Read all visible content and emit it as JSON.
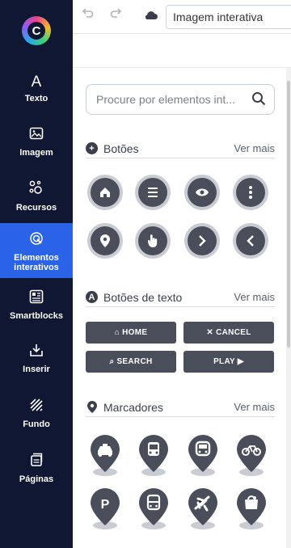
{
  "sidebar": {
    "logo": "C",
    "items": [
      {
        "label": "Texto",
        "icon": "A"
      },
      {
        "label": "Imagem",
        "icon": "🖼"
      },
      {
        "label": "Recursos",
        "icon": "⚙"
      },
      {
        "label": "Elementos interativos",
        "icon": "◎"
      },
      {
        "label": "Smartblocks",
        "icon": "▦"
      },
      {
        "label": "Inserir",
        "icon": "⬚"
      },
      {
        "label": "Fundo",
        "icon": "▨"
      },
      {
        "label": "Páginas",
        "icon": "▤"
      }
    ],
    "active_index": 3,
    "active_color": "#2b63e8"
  },
  "topbar": {
    "undo_icon": "undo-icon",
    "redo_icon": "redo-icon",
    "cloud_icon": "cloud-icon",
    "title_value": "Imagem interativa"
  },
  "search": {
    "placeholder": "Procure por elementos int..."
  },
  "sections": {
    "buttons": {
      "title": "Botões",
      "more": "Ver mais",
      "icon": "+"
    },
    "text_buttons": {
      "title": "Botões de texto",
      "more": "Ver mais",
      "icon": "A"
    },
    "markers": {
      "title": "Marcadores",
      "more": "Ver mais",
      "icon": "pin"
    }
  },
  "icon_buttons": [
    "home",
    "menu",
    "eye",
    "more-vertical",
    "location",
    "hand",
    "chevron-right",
    "chevron-left"
  ],
  "text_buttons": [
    {
      "label": "⌂ HOME"
    },
    {
      "label": "✕ CANCEL"
    },
    {
      "label": "⌕ SEARCH"
    },
    {
      "label": "PLAY ▶"
    }
  ],
  "markers": [
    "taxi",
    "bus",
    "train",
    "bicycle",
    "parking",
    "bus-2",
    "airplane",
    "bag"
  ],
  "colors": {
    "sidebar_bg": "#0f1732",
    "button_dark": "#4a4e5a",
    "button_ring": "#c9ccd3"
  }
}
